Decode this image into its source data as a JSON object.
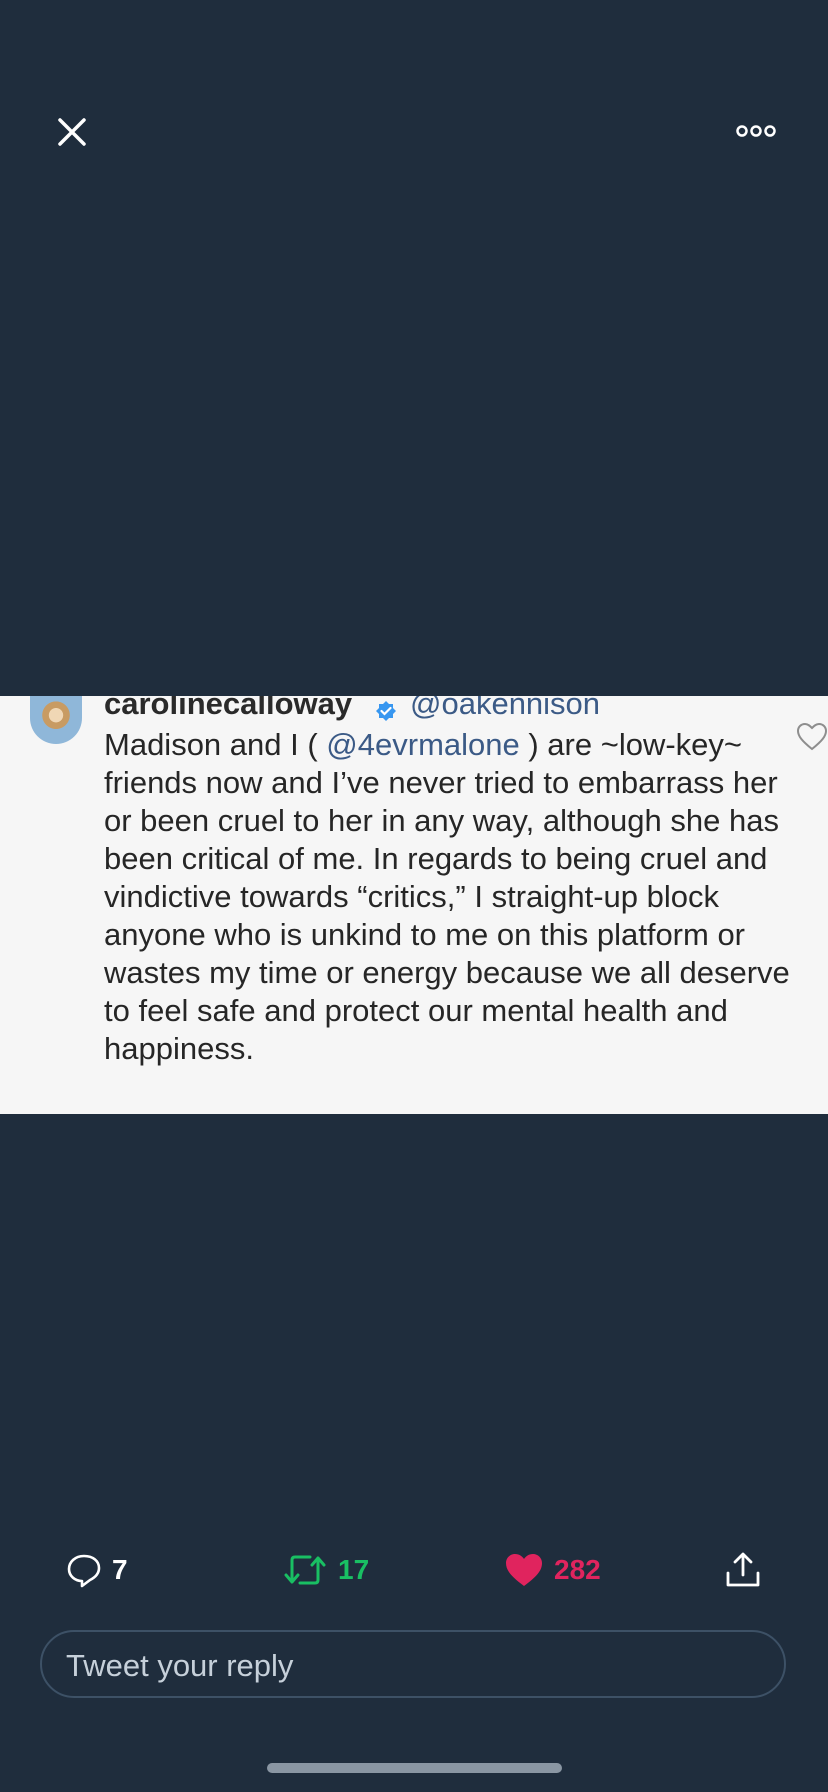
{
  "topbar": {
    "close_icon": "close-icon",
    "more_icon": "more-icon"
  },
  "media": {
    "username": "carolinecalloway",
    "mention": "@oakennison",
    "text_before": "Madison and I ( ",
    "text_mention": "@4evrmalone",
    "text_after": " ) are ~low-key~ friends now and I’ve never tried to embarrass her or been cruel to her in any way, although she has been critical of me. In regards to being cruel and vindictive towards “critics,” I straight-up block anyone who is unkind to me on this platform or wastes my time or energy because we all deserve to feel safe and protect our mental health and happiness."
  },
  "actions": {
    "replies": "7",
    "retweets": "17",
    "likes": "282"
  },
  "reply": {
    "placeholder": "Tweet your reply"
  },
  "colors": {
    "background": "#1f2d3d",
    "retweet": "#19bf63",
    "like": "#e0245e"
  }
}
